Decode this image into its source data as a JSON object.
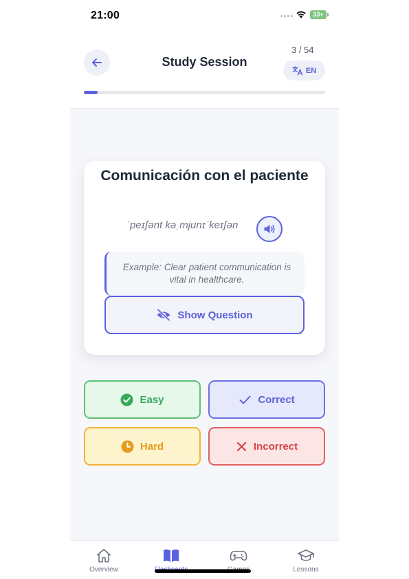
{
  "status_bar": {
    "time": "21:00",
    "battery": "33+"
  },
  "header": {
    "title": "Study Session",
    "counter": "3 / 54",
    "language_label": "EN",
    "progress": 0.056
  },
  "card": {
    "word": "Comunicación con el paciente",
    "phonetic": "ˈpeɪʃənt kəˌmjunɪˈkeɪʃən",
    "example": "Example: Clear patient communication is vital in healthcare.",
    "show_question_label": "Show Question"
  },
  "answers": {
    "easy": "Easy",
    "correct": "Correct",
    "hard": "Hard",
    "incorrect": "Incorrect"
  },
  "tabs": [
    {
      "label": "Overview",
      "icon": "home-icon"
    },
    {
      "label": "Flashcards",
      "icon": "book-icon",
      "active": true
    },
    {
      "label": "Games",
      "icon": "gamepad-icon"
    },
    {
      "label": "Lessons",
      "icon": "graduation-cap-icon"
    }
  ],
  "colors": {
    "accent": "#5b62e0",
    "easy": "#3aa85a",
    "hard": "#e69a1e",
    "incorrect": "#d64545"
  }
}
